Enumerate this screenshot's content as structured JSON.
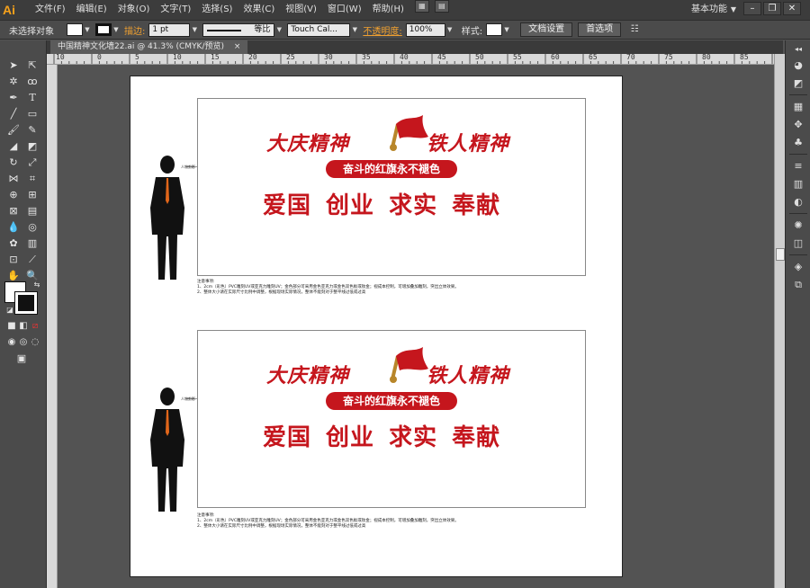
{
  "app": {
    "logo": "Ai",
    "workspace": "基本功能",
    "window_controls": [
      "–",
      "❐",
      "✕"
    ]
  },
  "menu": [
    "文件(F)",
    "编辑(E)",
    "对象(O)",
    "文字(T)",
    "选择(S)",
    "效果(C)",
    "视图(V)",
    "窗口(W)",
    "帮助(H)"
  ],
  "control_bar": {
    "selection": "未选择对象",
    "stroke_label": "描边:",
    "stroke_weight": "1 pt",
    "stroke_style": "等比",
    "brush": "Touch Cal...",
    "opacity_label": "不透明度:",
    "opacity_value": "100%",
    "style_label": "样式:",
    "doc_setup": "文档设置",
    "preferences": "首选项"
  },
  "document": {
    "tab_title": "中国精神文化墙22.ai @ 41.3% (CMYK/预览)",
    "tab_close": "×"
  },
  "ruler": {
    "top_labels": [
      "10",
      "0",
      "5",
      "10",
      "15",
      "20",
      "25",
      "30",
      "35",
      "40",
      "45",
      "50",
      "55",
      "60",
      "65",
      "70",
      "75",
      "80",
      "85"
    ]
  },
  "artwork": {
    "title_left": "大庆精神",
    "title_right": "铁人精神",
    "banner": "奋斗的红旗永不褪色",
    "slogan": "爱国 创业 求实 奉献",
    "figure_label": "人物剪影",
    "notes_heading": "注意事项:",
    "notes_line1": "1、2cm（彩色）PVC雕刻UV或亚克力雕刻UV；金色部分可采用金色亚克力或金色双色板或钛金；视成本控制，可增加叠加雕刻，突出立体效果。",
    "notes_line2": "2、整体大小请在实际尺寸比例中调整，根据现场实际情况，整体不能刻对于整平线过低或过高"
  },
  "colors": {
    "brand_red": "#c5161d",
    "ai_orange": "#f7a21b"
  }
}
